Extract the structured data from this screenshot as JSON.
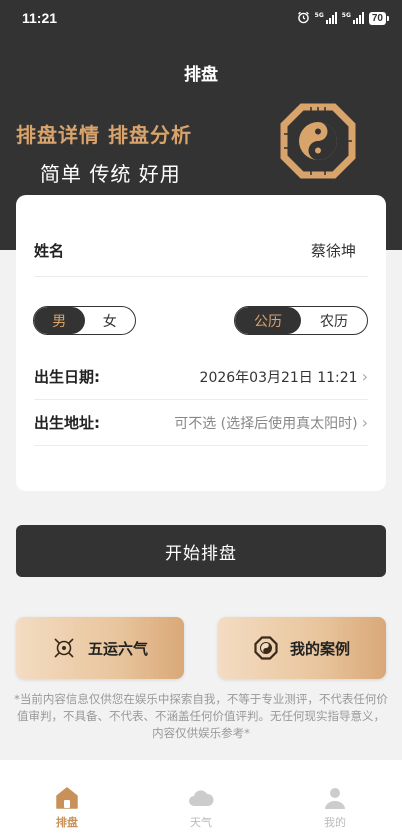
{
  "status_bar": {
    "time": "11:21",
    "signal1_label": "5G",
    "signal2_label": "5G",
    "battery": "70",
    "alarm_icon": "alarm-icon"
  },
  "header": {
    "title": "排盘",
    "hero_title": "排盘详情 排盘分析",
    "hero_subtitle": "简单 传统 好用",
    "logo_icon": "bagua-yinyang-icon"
  },
  "form": {
    "name_label": "姓名",
    "name_value": "蔡徐坤",
    "gender_options": [
      "男",
      "女"
    ],
    "gender_selected": "男",
    "calendar_options": [
      "公历",
      "农历"
    ],
    "calendar_selected": "公历",
    "birth_date_label": "出生日期:",
    "birth_date_value": "2026年03月21日 11:21",
    "birth_place_label": "出生地址:",
    "birth_place_placeholder": "可不选 (选择后使用真太阳时)"
  },
  "actions": {
    "start_label": "开始排盘",
    "feature_left_label": "五运六气",
    "feature_right_label": "我的案例"
  },
  "disclaimer": "*当前内容信息仅供您在娱乐中探索自我，不等于专业测评，不代表任何价值审判，不具备、不代表、不涵盖任何价值评判。无任何现实指导意义，内容仅供娱乐参考*",
  "bottom_nav": {
    "items": [
      {
        "label": "排盘",
        "icon": "home-icon",
        "active": true
      },
      {
        "label": "天气",
        "icon": "cloud-icon",
        "active": false
      },
      {
        "label": "我的",
        "icon": "user-icon",
        "active": false
      }
    ]
  },
  "colors": {
    "dark": "#333333",
    "gold": "#d9a36c",
    "accent": "#c8915a"
  }
}
